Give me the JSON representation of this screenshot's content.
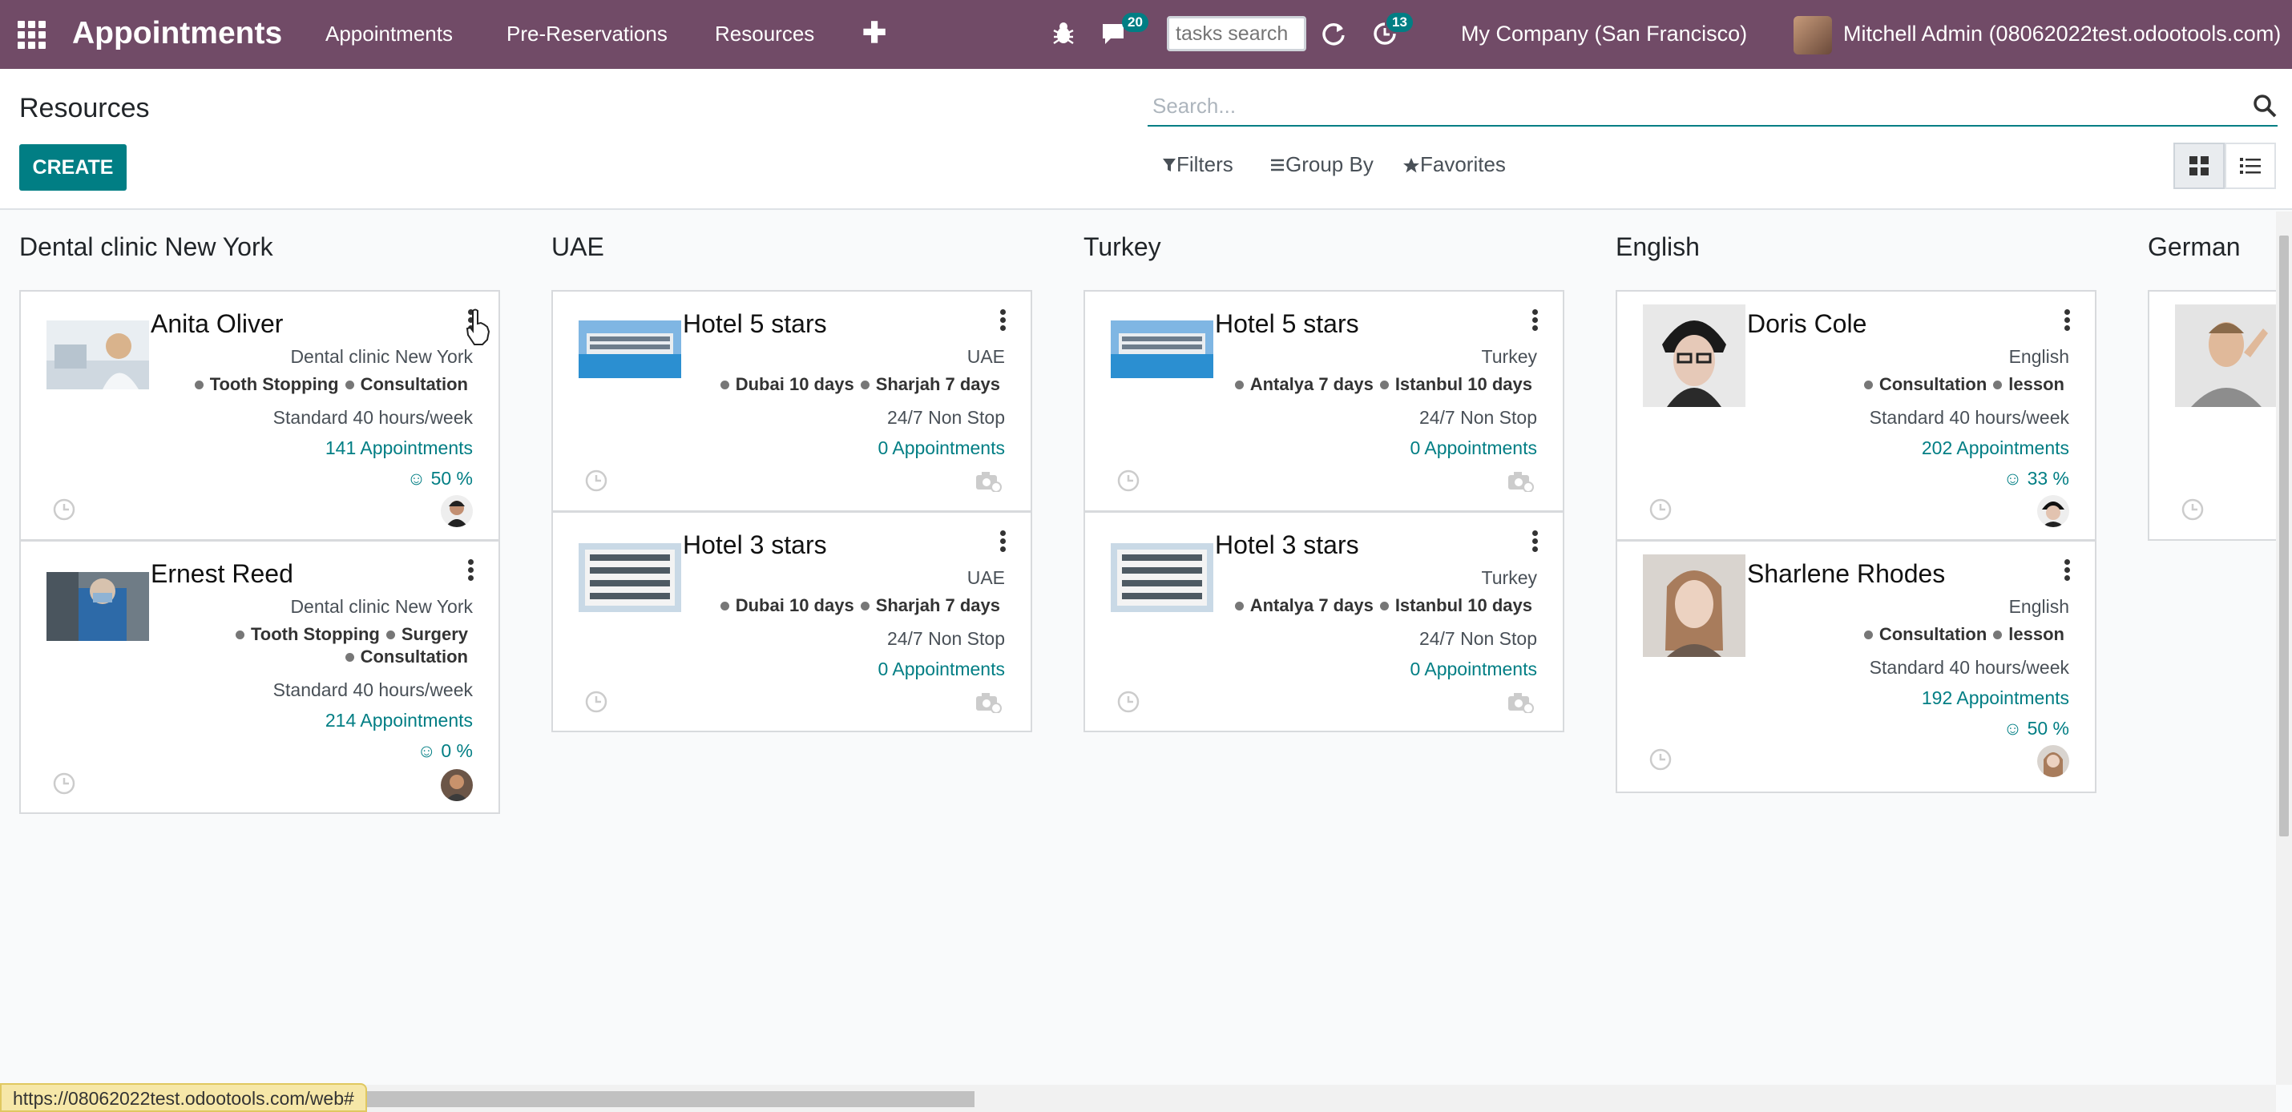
{
  "navbar": {
    "brand": "Appointments",
    "menu": [
      "Appointments",
      "Pre-Reservations",
      "Resources"
    ],
    "plus": "✚",
    "messages_count": "20",
    "tasks_search_placeholder": "tasks search",
    "activity_count": "13",
    "company": "My Company (San Francisco)",
    "user": "Mitchell Admin (08062022test.odootools.com)",
    "color": "#714b67"
  },
  "control_panel": {
    "title": "Resources",
    "create_label": "CREATE",
    "search_placeholder": "Search...",
    "filters_label": "Filters",
    "group_by_label": "Group By",
    "favorites_label": "Favorites"
  },
  "columns": [
    {
      "title": "Dental clinic New York",
      "cards": [
        {
          "name": "Anita Oliver",
          "group": "Dental clinic New York",
          "tags": [
            "Tooth Stopping",
            "Consultation"
          ],
          "schedule": "Standard 40 hours/week",
          "appointments": "141 Appointments",
          "rating": "☺ 50 %"
        },
        {
          "name": "Ernest Reed",
          "group": "Dental clinic New York",
          "tags_line1": [
            "Tooth Stopping",
            "Surgery"
          ],
          "tags_line2": [
            "Consultation"
          ],
          "schedule": "Standard 40 hours/week",
          "appointments": "214 Appointments",
          "rating": "☺ 0 %"
        }
      ]
    },
    {
      "title": "UAE",
      "cards": [
        {
          "name": "Hotel 5 stars",
          "group": "UAE",
          "tags": [
            "Dubai 10 days",
            "Sharjah 7 days"
          ],
          "schedule": "24/7 Non Stop",
          "appointments": "0 Appointments"
        },
        {
          "name": "Hotel 3 stars",
          "group": "UAE",
          "tags": [
            "Dubai 10 days",
            "Sharjah 7 days"
          ],
          "schedule": "24/7 Non Stop",
          "appointments": "0 Appointments"
        }
      ]
    },
    {
      "title": "Turkey",
      "cards": [
        {
          "name": "Hotel 5 stars",
          "group": "Turkey",
          "tags": [
            "Antalya 7 days",
            "Istanbul 10 days"
          ],
          "schedule": "24/7 Non Stop",
          "appointments": "0 Appointments"
        },
        {
          "name": "Hotel 3 stars",
          "group": "Turkey",
          "tags": [
            "Antalya 7 days",
            "Istanbul 10 days"
          ],
          "schedule": "24/7 Non Stop",
          "appointments": "0 Appointments"
        }
      ]
    },
    {
      "title": "English",
      "cards": [
        {
          "name": "Doris Cole",
          "group": "English",
          "tags": [
            "Consultation",
            "lesson"
          ],
          "schedule": "Standard 40 hours/week",
          "appointments": "202 Appointments",
          "rating": "☺ 33 %"
        },
        {
          "name": "Sharlene Rhodes",
          "group": "English",
          "tags": [
            "Consultation",
            "lesson"
          ],
          "schedule": "Standard 40 hours/week",
          "appointments": "192 Appointments",
          "rating": "☺ 50 %"
        }
      ]
    },
    {
      "title": "German",
      "cards": []
    }
  ],
  "status_url": "https://08062022test.odootools.com/web#",
  "accent_color": "#017e84"
}
